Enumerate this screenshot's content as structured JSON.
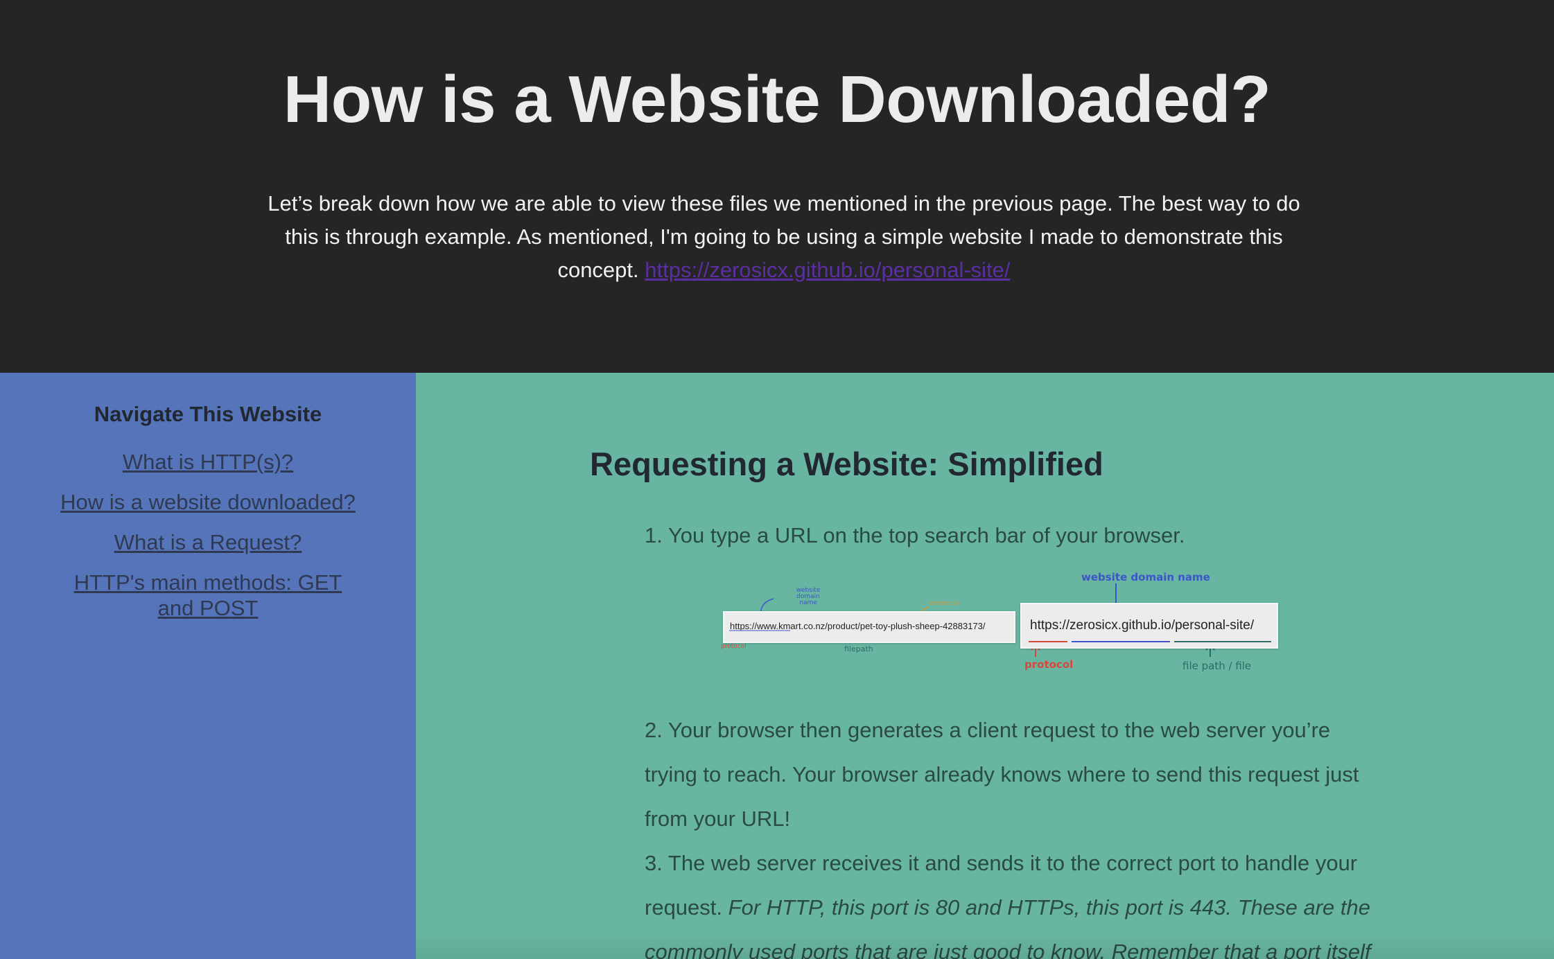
{
  "header": {
    "title": "How is a Website Downloaded?",
    "intro_text": "Let’s break down how we are able to view these files we mentioned in the previous page. The best way to do this is through example. As mentioned, I'm going to be using a simple website I made to demonstrate this concept.",
    "intro_link": "https://zerosicx.github.io/personal-site/"
  },
  "sidebar": {
    "title": "Navigate This Website",
    "items": [
      {
        "label": "What is HTTP(s)?"
      },
      {
        "label": "How is a website downloaded?"
      },
      {
        "label": "What is a Request?"
      },
      {
        "label": "HTTP's main methods: GET and POST"
      }
    ]
  },
  "main": {
    "section_title": "Requesting a Website: Simplified",
    "step1": "1. You type a URL on the top search bar of your browser.",
    "step2": "2. Your browser then generates a client request to the web server you’re trying to reach. Your browser already knows where to send this request just from your URL!",
    "step3_plain": "3. The web server receives it and sends it to the correct port to handle your request.",
    "step3_italic": "For HTTP, this port is 80 and HTTPs, this port is 443. These are the commonly used ports that are just good to know. Remember that a port itself",
    "figure": {
      "small_url": "https://www.kmart.co.nz/product/pet-toy-plush-sheep-42883173/",
      "small_domain_label": "website domain name",
      "small_extension_label": "extension",
      "small_protocol_label": "protocol",
      "small_filepath_label": "filepath",
      "large_url": "https://zerosicx.github.io/personal-site/",
      "large_domain_label": "website domain name",
      "large_protocol_label": "protocol",
      "large_filepath_label": "file path / file"
    }
  },
  "colors": {
    "header_bg": "#252525",
    "sidebar_bg": "#5574ba",
    "main_bg": "#68b6a2",
    "link_visited": "#5b2fa3",
    "protocol_red": "#d9473b",
    "domain_blue": "#3d55c9",
    "filepath_teal": "#2f6a66",
    "extension_orange": "#d49a3a"
  }
}
